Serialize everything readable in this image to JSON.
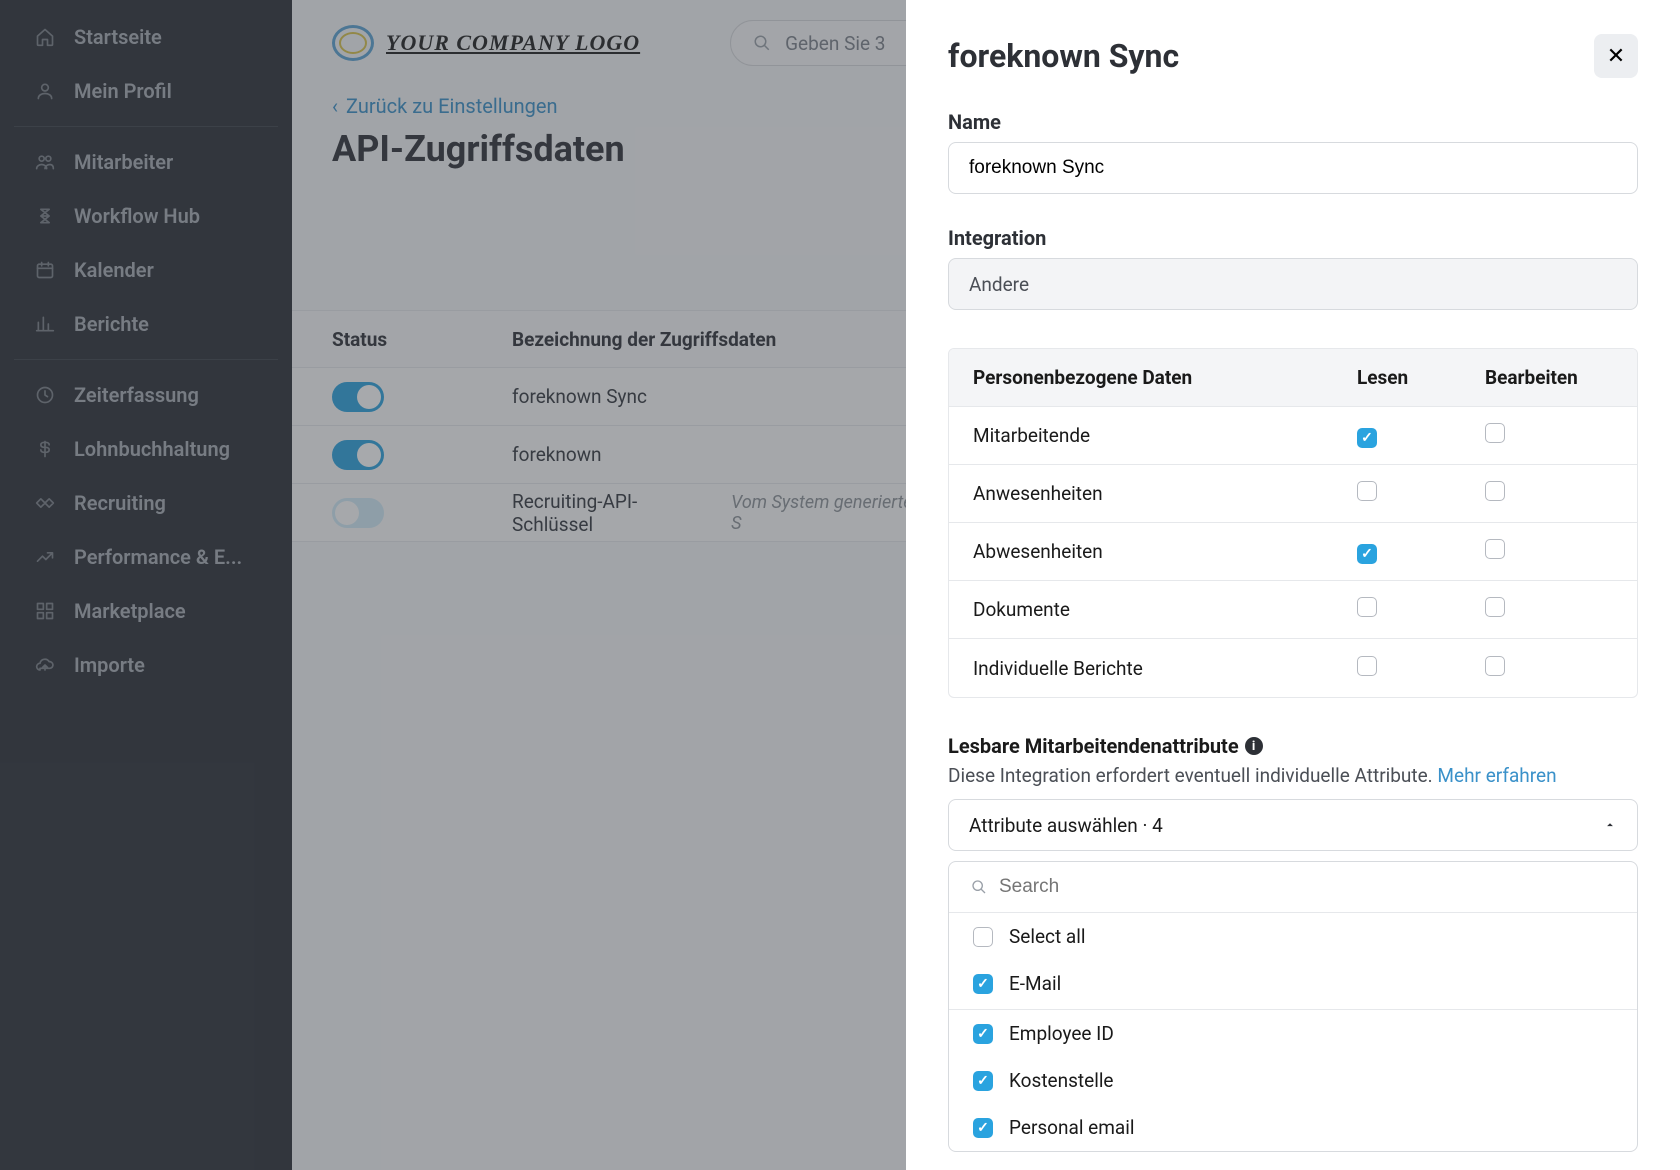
{
  "sidebar": {
    "groups": [
      [
        {
          "label": "Startseite",
          "icon": "home"
        },
        {
          "label": "Mein Profil",
          "icon": "user"
        }
      ],
      [
        {
          "label": "Mitarbeiter",
          "icon": "users"
        },
        {
          "label": "Workflow Hub",
          "icon": "flow"
        },
        {
          "label": "Kalender",
          "icon": "calendar"
        },
        {
          "label": "Berichte",
          "icon": "chart"
        }
      ],
      [
        {
          "label": "Zeiterfassung",
          "icon": "clock"
        },
        {
          "label": "Lohnbuchhaltung",
          "icon": "dollar"
        },
        {
          "label": "Recruiting",
          "icon": "handshake"
        },
        {
          "label": "Performance & E...",
          "icon": "trend"
        },
        {
          "label": "Marketplace",
          "icon": "grid"
        },
        {
          "label": "Importe",
          "icon": "cloud"
        }
      ]
    ]
  },
  "logo_text": "YOUR COMPANY LOGO",
  "search_placeholder": "Geben Sie 3",
  "back_link": "Zurück zu Einstellungen",
  "page_title": "API-Zugriffsdaten",
  "table": {
    "headers": {
      "status": "Status",
      "label": "Bezeichnung der Zugriffsdaten"
    },
    "rows": [
      {
        "on": true,
        "label": "foreknown Sync",
        "note": ""
      },
      {
        "on": true,
        "label": "foreknown",
        "note": ""
      },
      {
        "on": true,
        "label": "Recruiting-API-Schlüssel",
        "note": "Vom System generierter S"
      }
    ]
  },
  "panel": {
    "title": "foreknown Sync",
    "name_label": "Name",
    "name_value": "foreknown Sync",
    "integration_label": "Integration",
    "integration_value": "Andere",
    "perm_headers": {
      "data": "Personenbezogene Daten",
      "read": "Lesen",
      "edit": "Bearbeiten"
    },
    "perm_rows": [
      {
        "label": "Mitarbeitende",
        "read": true,
        "edit": false
      },
      {
        "label": "Anwesenheiten",
        "read": false,
        "edit": false
      },
      {
        "label": "Abwesenheiten",
        "read": true,
        "edit": false
      },
      {
        "label": "Dokumente",
        "read": false,
        "edit": false
      },
      {
        "label": "Individuelle Berichte",
        "read": false,
        "edit": false
      }
    ],
    "attr_section_label": "Lesbare Mitarbeitendenattribute",
    "attr_desc": "Diese Integration erfordert eventuell individuelle Attribute. ",
    "attr_link": "Mehr erfahren",
    "select_text": "Attribute auswählen · 4",
    "search_placeholder": "Search",
    "select_all": "Select all",
    "options": [
      {
        "label": "E-Mail",
        "checked": true
      },
      {
        "label": "Employee ID",
        "checked": true
      },
      {
        "label": "Kostenstelle",
        "checked": true
      },
      {
        "label": "Personal email",
        "checked": true
      }
    ]
  }
}
